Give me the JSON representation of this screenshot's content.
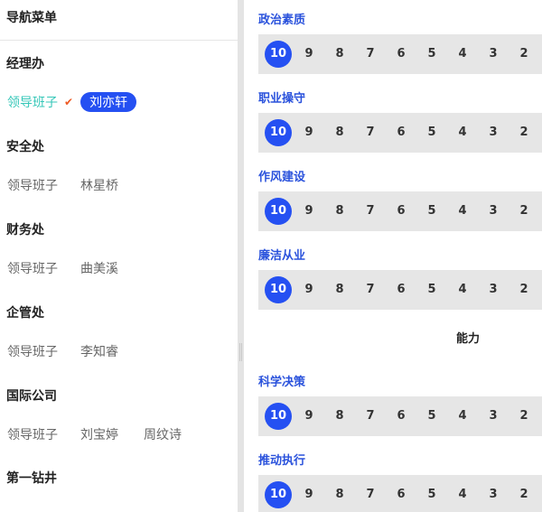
{
  "sidebar": {
    "header": "导航菜单",
    "departments": [
      {
        "name": "经理办",
        "group": "领导班子",
        "group_active": true,
        "people": [
          {
            "name": "刘亦轩",
            "selected": true
          }
        ]
      },
      {
        "name": "安全处",
        "group": "领导班子",
        "group_active": false,
        "people": [
          {
            "name": "林星桥",
            "selected": false
          }
        ]
      },
      {
        "name": "财务处",
        "group": "领导班子",
        "group_active": false,
        "people": [
          {
            "name": "曲美溪",
            "selected": false
          }
        ]
      },
      {
        "name": "企管处",
        "group": "领导班子",
        "group_active": false,
        "people": [
          {
            "name": "李知睿",
            "selected": false
          }
        ]
      },
      {
        "name": "国际公司",
        "group": "领导班子",
        "group_active": false,
        "people": [
          {
            "name": "刘宝婷",
            "selected": false
          },
          {
            "name": "周纹诗",
            "selected": false
          }
        ]
      },
      {
        "name": "第一钻井"
      }
    ]
  },
  "main": {
    "scale": [
      "10",
      "9",
      "8",
      "7",
      "6",
      "5",
      "4",
      "3",
      "2"
    ],
    "items_a": [
      {
        "title": "政治素质",
        "selected": "10"
      },
      {
        "title": "职业操守",
        "selected": "10"
      },
      {
        "title": "作风建设",
        "selected": "10"
      },
      {
        "title": "廉洁从业",
        "selected": "10"
      }
    ],
    "section_b": "能力",
    "items_b": [
      {
        "title": "科学决策",
        "selected": "10"
      },
      {
        "title": "推动执行",
        "selected": "10"
      }
    ]
  },
  "colors": {
    "accent": "#2550f2",
    "title": "#2a52dc",
    "active_group": "#35c7b8",
    "check": "#ee5a24",
    "bar": "#e6e6e6"
  }
}
